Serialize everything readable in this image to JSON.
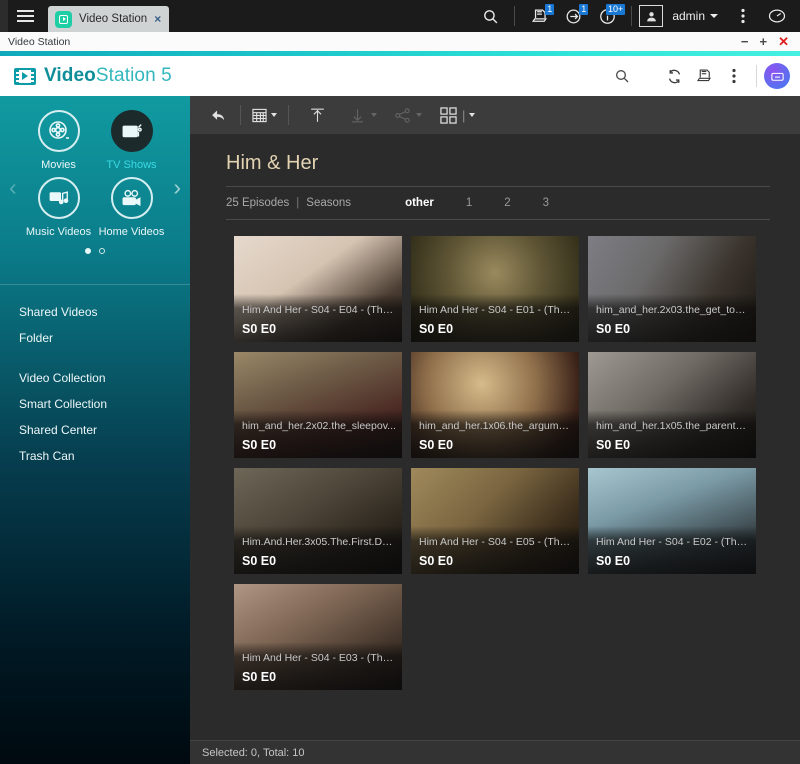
{
  "taskbar": {
    "menu_icon": "hamburger-icon",
    "tab": {
      "label": "Video Station",
      "icon": "video-station-icon",
      "close": "×"
    },
    "search_icon": "search-icon",
    "notifications": [
      {
        "name": "log-icon",
        "badge": "1"
      },
      {
        "name": "sync-icon",
        "badge": "1"
      },
      {
        "name": "info-icon",
        "badge": "10+"
      }
    ],
    "user_icon": "user-icon",
    "user_name": "admin",
    "options_icon": "more-vertical-icon",
    "monitor_icon": "resource-monitor-icon"
  },
  "window": {
    "title": "Video Station",
    "minimize": "−",
    "maximize": "+",
    "close": "✕"
  },
  "app_header": {
    "brand_bold": "Video",
    "brand_rest": "Station 5",
    "logo_icon": "film-strip-icon",
    "icons": [
      "search-icon",
      "refresh-icon",
      "log-icon",
      "more-vertical-icon"
    ],
    "avatar_icon": "user-avatar-icon"
  },
  "sidebar": {
    "categories": [
      {
        "label": "Movies",
        "icon": "film-reel-icon",
        "active": false
      },
      {
        "label": "TV Shows",
        "icon": "tv-icon",
        "active": true
      },
      {
        "label": "Music Videos",
        "icon": "music-video-icon",
        "active": false
      },
      {
        "label": "Home Videos",
        "icon": "video-camera-icon",
        "active": false
      }
    ],
    "prev_arrow": "‹",
    "next_arrow": "›",
    "pager": [
      "filled",
      "empty"
    ],
    "menu_group_1": [
      "Shared Videos",
      "Folder"
    ],
    "menu_group_2": [
      "Video Collection",
      "Smart Collection",
      "Shared Center",
      "Trash Can"
    ]
  },
  "toolbar": {
    "back_icon": "back-arrow-icon",
    "view_icon": "grid-view-icon",
    "upload_icon": "upload-icon",
    "download_icon": "download-icon",
    "share_icon": "share-icon",
    "category_icon": "category-icon"
  },
  "main": {
    "title": "Him & Her",
    "episode_count": "25 Episodes",
    "divider": "|",
    "seasons_label": "Seasons",
    "season_tabs": [
      {
        "label": "other",
        "active": true
      },
      {
        "label": "1",
        "active": false
      },
      {
        "label": "2",
        "active": false
      },
      {
        "label": "3",
        "active": false
      }
    ],
    "cards": [
      {
        "name": "Him And Her - S04 - E04 - (The ...",
        "se": "S0 E0",
        "c1": "#d8c5b4",
        "c2": "#3a3026",
        "c3": "#e8d9cc"
      },
      {
        "name": "Him And Her - S04 - E01 - (The ...",
        "se": "S0 E0",
        "c1": "#6e6a3c",
        "c2": "#201c12",
        "c3": "#8f7a4c"
      },
      {
        "name": "him_and_her.2x03.the_get_toge...",
        "se": "S0 E0",
        "c1": "#6b6f7e",
        "c2": "#241f1c",
        "c3": "#8d8374"
      },
      {
        "name": "him_and_her.2x02.the_sleepov...",
        "se": "S0 E0",
        "c1": "#7b6a55",
        "c2": "#2a1d18",
        "c3": "#5c4338"
      },
      {
        "name": "him_and_her.1x06.the_argume...",
        "se": "S0 E0",
        "c1": "#b99a6a",
        "c2": "#2c1c14",
        "c3": "#7d5a40"
      },
      {
        "name": "him_and_her.1x05.the_parents....",
        "se": "S0 E0",
        "c1": "#8d8a84",
        "c2": "#1e1c1a",
        "c3": "#6a6560"
      },
      {
        "name": "Him.And.Her.3x05.The.First.Dat...",
        "se": "S0 E0",
        "c1": "#5f5a4e",
        "c2": "#231f1a",
        "c3": "#46423a"
      },
      {
        "name": "Him And Her - S04 - E05 - (The ...",
        "se": "S0 E0",
        "c1": "#8c7a56",
        "c2": "#241d14",
        "c3": "#6d5a3c"
      },
      {
        "name": "Him And Her - S04 - E02 - (The ...",
        "se": "S0 E0",
        "c1": "#8fb7c4",
        "c2": "#232a2e",
        "c3": "#5f7d88"
      },
      {
        "name": "Him And Her - S04 - E03 - (The ...",
        "se": "S0 E0",
        "c1": "#9a7f6d",
        "c2": "#241c18",
        "c3": "#6d5a4c"
      }
    ]
  },
  "status": {
    "text": "Selected: 0, Total: 10"
  },
  "colors": {
    "accent": "#1ecfa6",
    "brand": "#0f8e99",
    "badge": "#1878d4",
    "title": "#e3d3b2"
  }
}
